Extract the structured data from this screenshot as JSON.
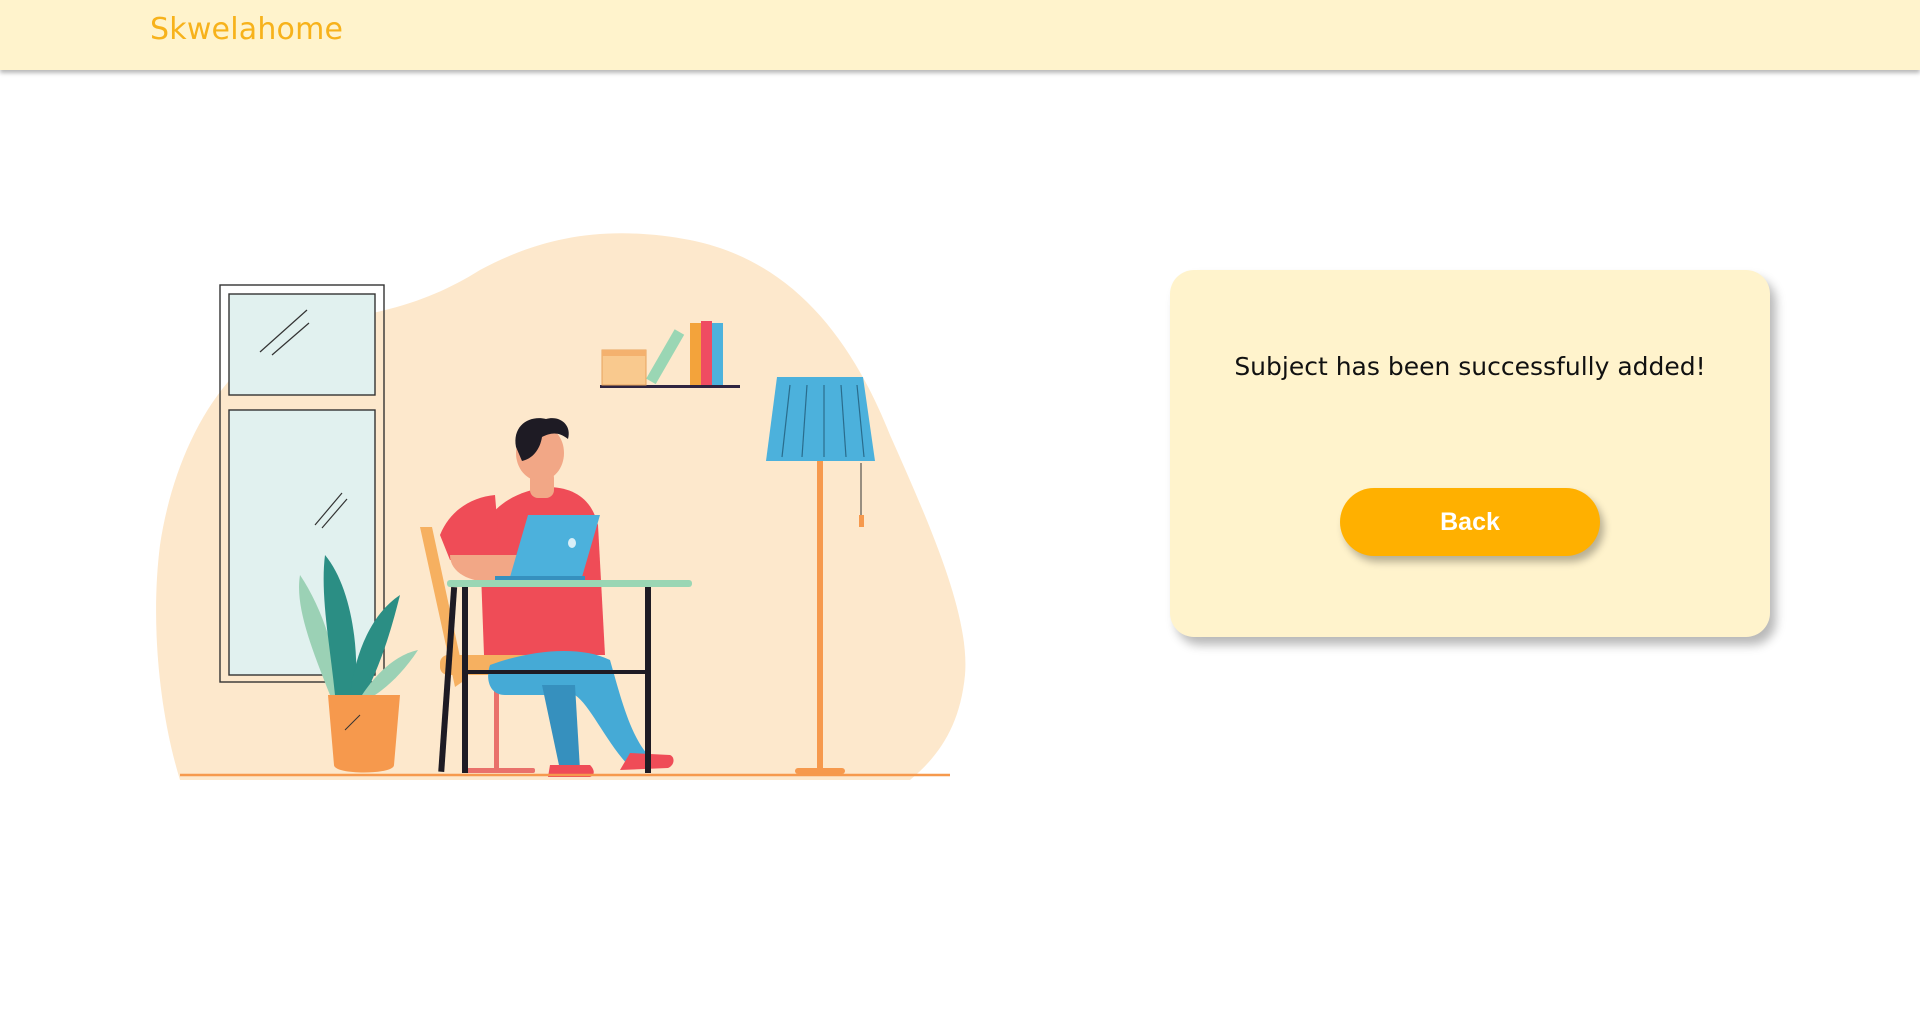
{
  "header": {
    "brand": "Skwelahome"
  },
  "main": {
    "message": "Subject has been successfully added!",
    "back_label": "Back"
  },
  "colors": {
    "header_background": "#fff3cc",
    "brand_text": "#f7b21b",
    "card_background": "#fff3cc",
    "button_background": "#ffb000",
    "button_text": "#ffffff"
  },
  "illustration": {
    "icon": "person-working-on-laptop-illustration"
  }
}
